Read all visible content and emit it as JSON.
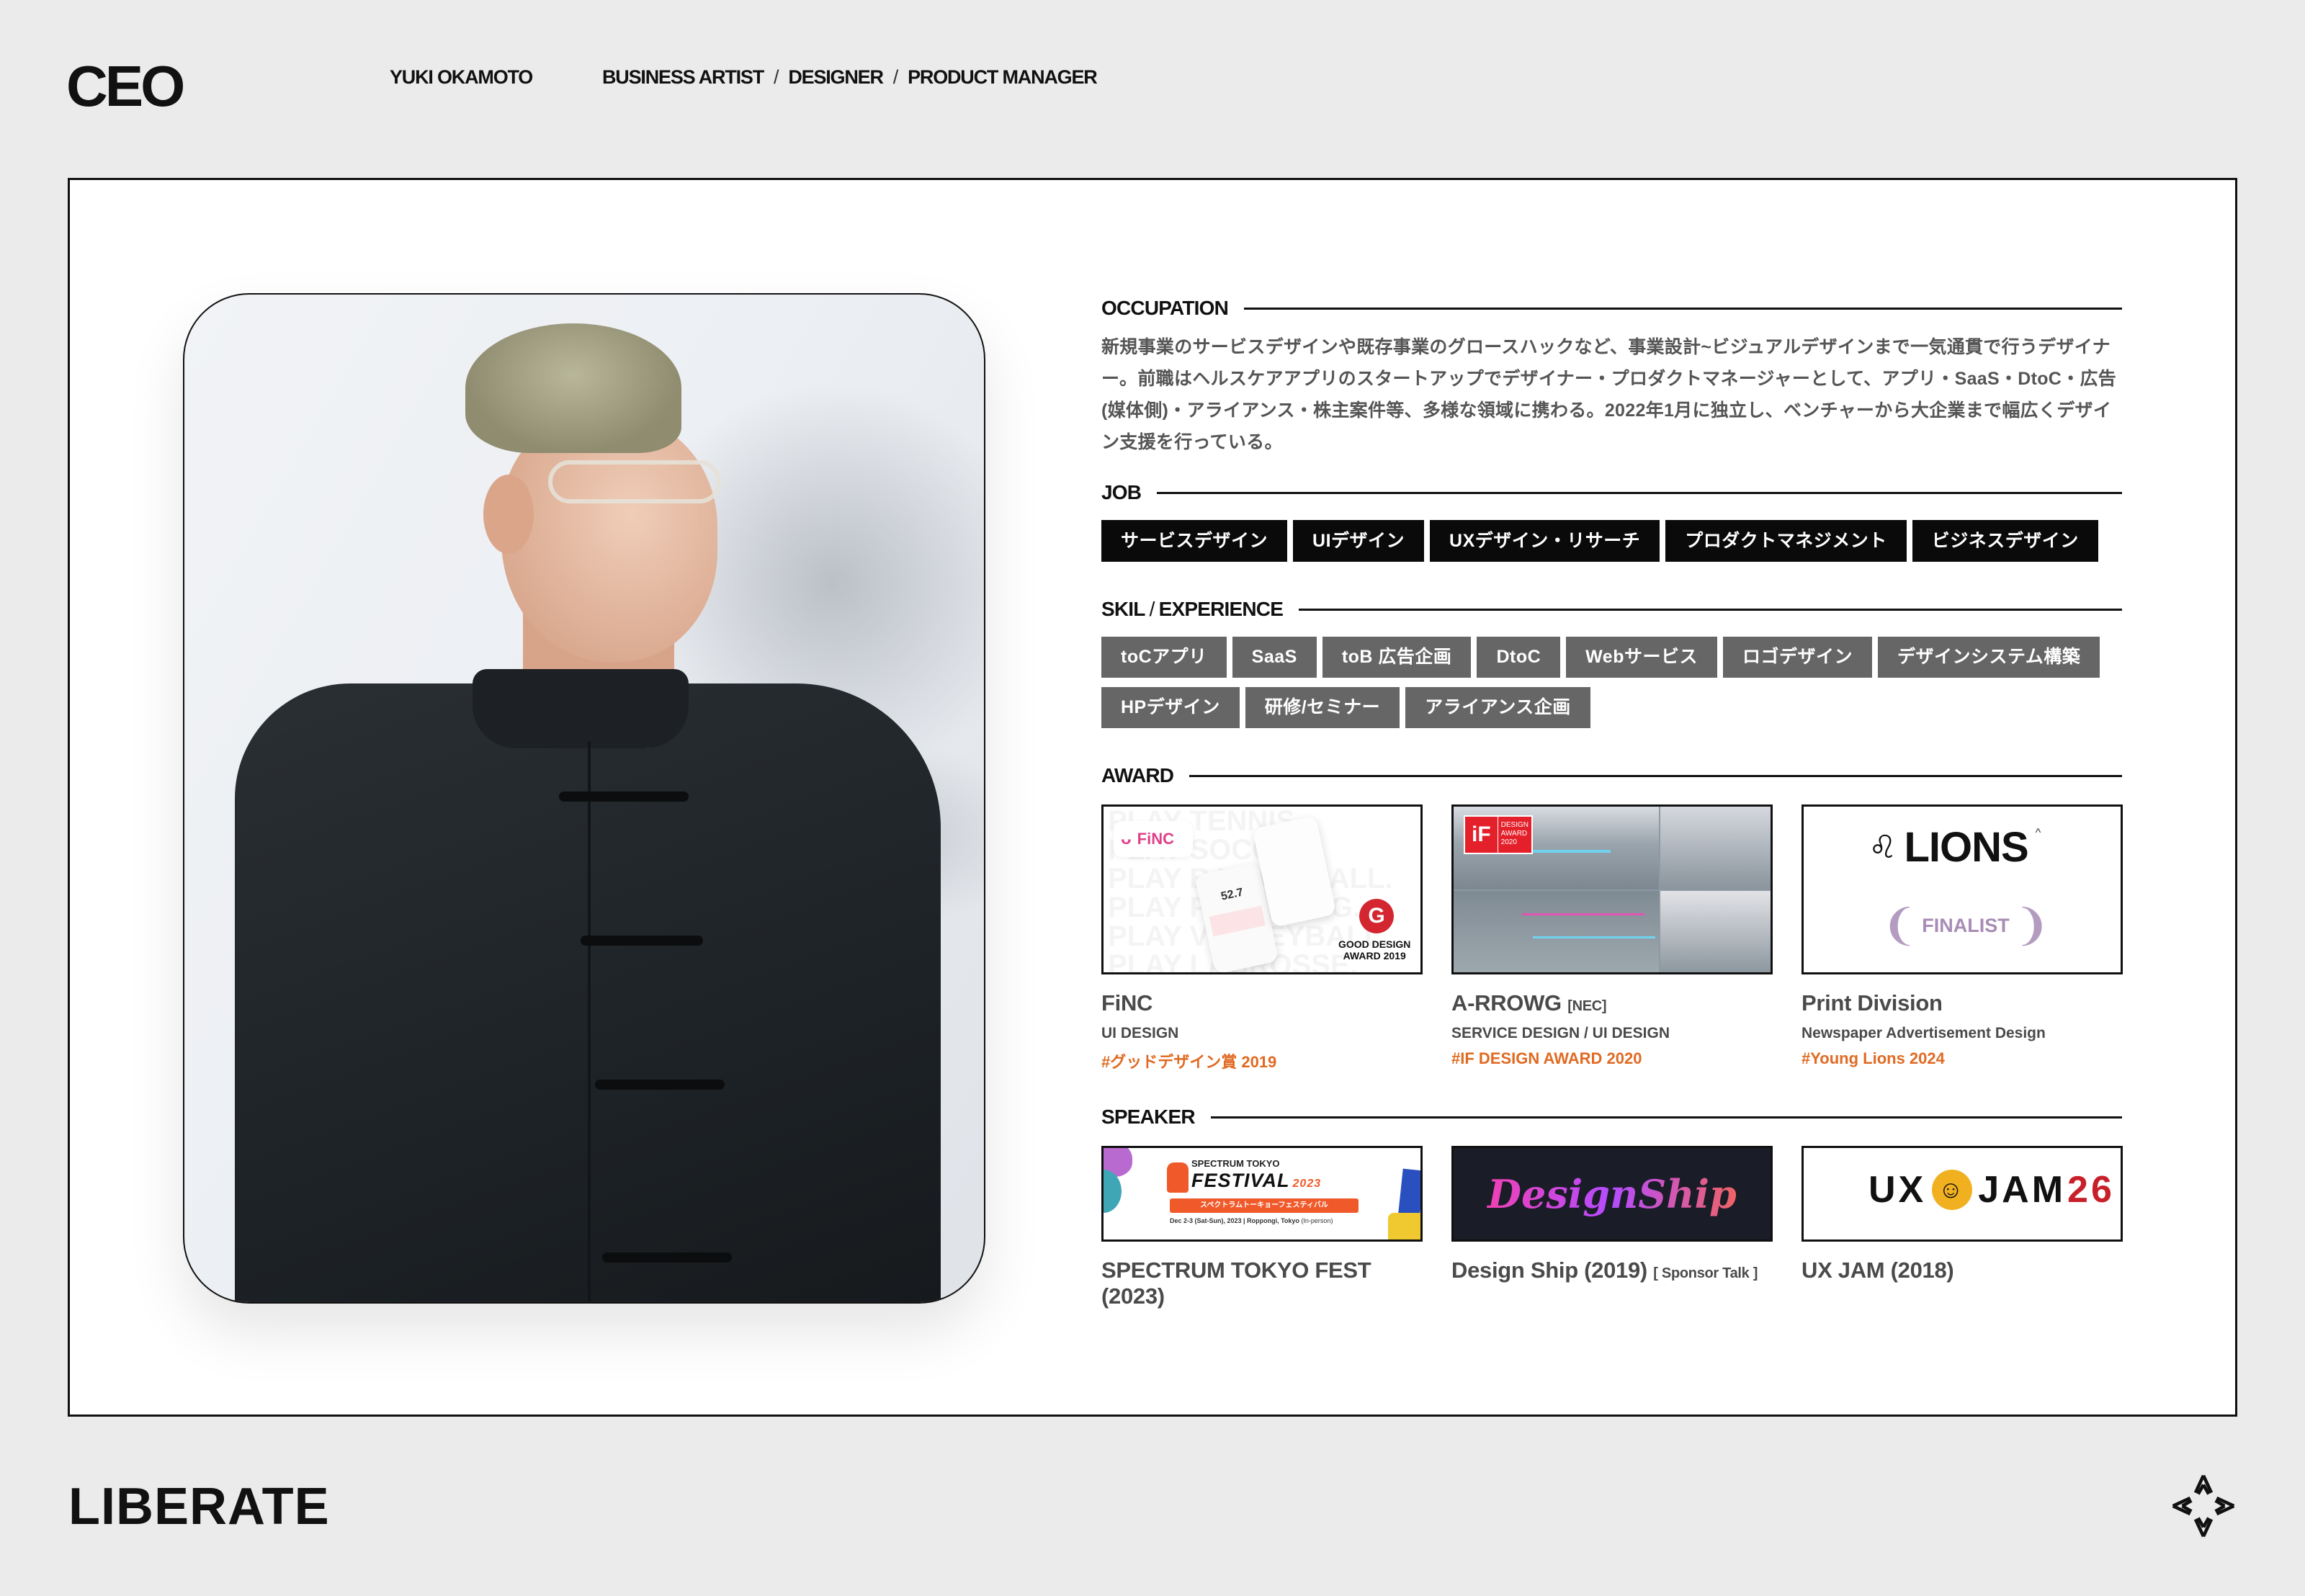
{
  "header": {
    "logo": "CEO",
    "name": "YUKI OKAMOTO",
    "roles": [
      "BUSINESS ARTIST",
      "DESIGNER",
      "PRODUCT MANAGER"
    ],
    "role_separator": "/"
  },
  "profile_photo": {
    "alt": "Portrait of Yuki Okamoto"
  },
  "occupation": {
    "heading": "OCCUPATION",
    "text": "新規事業のサービスデザインや既存事業のグロースハックなど、事業設計~ビジュアルデザインまで一気通貫で行うデザイナー。前職はヘルスケアアプリのスタートアップでデザイナー・プロダクトマネージャーとして、アプリ・SaaS・DtoC・広告(媒体側)・アライアンス・株主案件等、多様な領域に携わる。2022年1月に独立し、ベンチャーから大企業まで幅広くデザイン支援を行っている。"
  },
  "job": {
    "heading": "JOB",
    "items": [
      "サービスデザイン",
      "UIデザイン",
      "UXデザイン・リサーチ",
      "プロダクトマネジメント",
      "ビジネスデザイン"
    ]
  },
  "skill": {
    "heading_a": "SKIL",
    "heading_sep": "/",
    "heading_b": "EXPERIENCE",
    "items": [
      "toCアプリ",
      "SaaS",
      "toB 広告企画",
      "DtoC",
      "Webサービス",
      "ロゴデザイン",
      "デザインシステム構築",
      "HPデザイン",
      "研修/セミナー",
      "アライアンス企画"
    ]
  },
  "award": {
    "heading": "AWARD",
    "items": [
      {
        "title": "FiNC",
        "title_suffix": "",
        "subtitle": "UI DESIGN",
        "tag": "#グッドデザイン賞 2019",
        "thumb": {
          "brand": "FiNC",
          "badge_line1": "GOOD DESIGN",
          "badge_line2": "AWARD 2019",
          "bg_words": [
            "PLAY TENNIS.",
            "PLAY SOCCER.",
            "PLAY BASKETBALL.",
            "PLAY PING PONG.",
            "PLAY VOLLEYBALL.",
            "PLAY LACROSSE."
          ],
          "screen_value": "52.7"
        }
      },
      {
        "title": "A-RROWG",
        "title_suffix": "[NEC]",
        "subtitle": "SERVICE DESIGN / UI DESIGN",
        "tag": "#IF DESIGN AWARD 2020",
        "thumb": {
          "badge_logo": "iF",
          "badge_line1": "DESIGN",
          "badge_line2": "AWARD",
          "badge_line3": "2020"
        }
      },
      {
        "title": "Print Division",
        "title_suffix": "",
        "subtitle": "Newspaper Advertisement Design",
        "tag": "#Young Lions 2024",
        "thumb": {
          "logo": "LIONS",
          "badge": "FINALIST"
        }
      }
    ]
  },
  "speaker": {
    "heading": "SPEAKER",
    "items": [
      {
        "title": "SPECTRUM TOKYO FEST (2023)",
        "note": "",
        "thumb": {
          "line1": "SPECTRUM TOKYO",
          "line2": "FESTIVAL",
          "year": "2023",
          "kana": "スペクトラムトーキョーフェスティバル",
          "date": "Dec 2-3 (Sat-Sun), 2023",
          "place": "Roppongi, Tokyo",
          "mode": "(In-person)"
        }
      },
      {
        "title": "Design Ship (2019)",
        "note": "[ Sponsor Talk ]",
        "thumb": {
          "logo": "DesignShip"
        }
      },
      {
        "title": "UX JAM (2018)",
        "note": "",
        "thumb": {
          "left": "UX",
          "right": "JAM",
          "num": "26"
        }
      }
    ]
  },
  "footer": {
    "brand": "LIBERATE",
    "mark_icon": "four-point-star-chevron-icon"
  },
  "colors": {
    "background": "#ebebeb",
    "ink": "#111111",
    "job_chip": "#0a0a0a",
    "skill_chip": "#666666",
    "body_text": "#555555",
    "card_title": "#4a4a4a",
    "tag_accent": "#e06a22",
    "finc_pink": "#e0408a",
    "if_red": "#e4202a",
    "lions_purple": "#b49cc0",
    "designship_bg": "#1a1c28",
    "uxjam_red": "#c8202a"
  }
}
